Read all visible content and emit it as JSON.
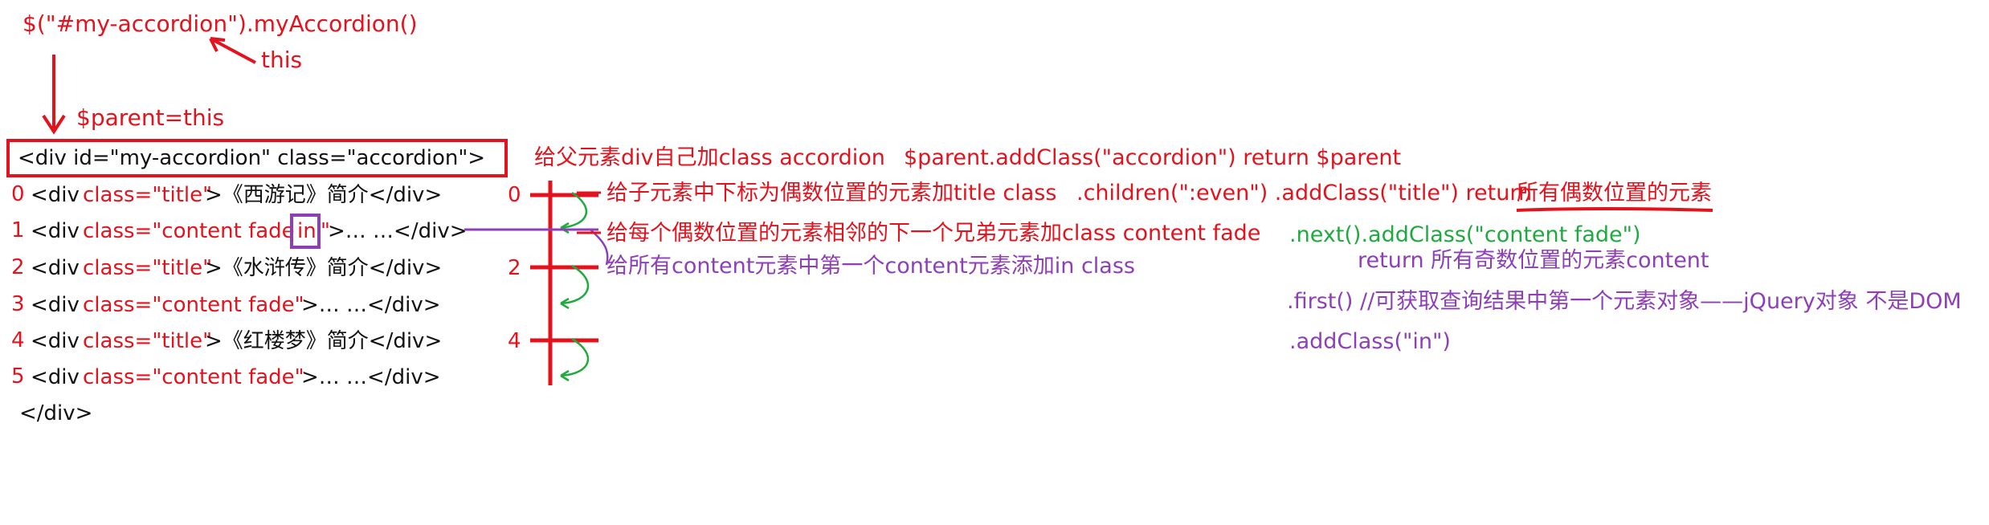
{
  "call_line": "$(\"#my-accordion\").myAccordion()",
  "this_label": "this",
  "parent_assign": "$parent=this",
  "root_tag": {
    "open": "<div  id=\"my-accordion\"  class=\"accordion\">",
    "close": "</div>"
  },
  "children": [
    {
      "index": "0",
      "open": "<div ",
      "attr": "class=\"title\"",
      "rest": ">《西游记》简介</div>"
    },
    {
      "index": "1",
      "open": "<div ",
      "attr": "class=\"content fade",
      "in": "in",
      "quote": "\"",
      "rest": ">… …</div>"
    },
    {
      "index": "2",
      "open": "<div ",
      "attr": "class=\"title\"",
      "rest": ">《水浒传》简介</div>"
    },
    {
      "index": "3",
      "open": "<div ",
      "attr": "class=\"content fade\"",
      "rest": ">… …</div>"
    },
    {
      "index": "4",
      "open": "<div ",
      "attr": "class=\"title\"",
      "rest": ">《红楼梦》简介</div>"
    },
    {
      "index": "5",
      "open": "<div ",
      "attr": "class=\"content fade\"",
      "rest": ">… …</div>"
    }
  ],
  "even_markers": [
    "0",
    "2",
    "4"
  ],
  "notes": {
    "parent_class_cn": "给父元素div自己加class accordion",
    "parent_class_code": "$parent.addClass(\"accordion\")  return $parent",
    "title_class_cn": "给子元素中下标为偶数位置的元素加title class",
    "title_class_code": ".children(\":even\") .addClass(\"title\")  return",
    "title_class_return": "所有偶数位置的元素",
    "content_class_cn": "给每个偶数位置的元素相邻的下一个兄弟元素加class content fade",
    "content_class_code": ".next().addClass(\"content fade\")",
    "content_class_return": "return 所有奇数位置的元素content",
    "in_class_cn": "给所有content元素中第一个content元素添加in class",
    "first_code": ".first() //可获取查询结果中第一个元素对象——jQuery对象 不是DOM",
    "add_in_code": ".addClass(\"in\")"
  },
  "colors": {
    "red": "#e3131e",
    "green": "#1faa3f",
    "purple": "#8e3fb8",
    "black": "#111111"
  }
}
